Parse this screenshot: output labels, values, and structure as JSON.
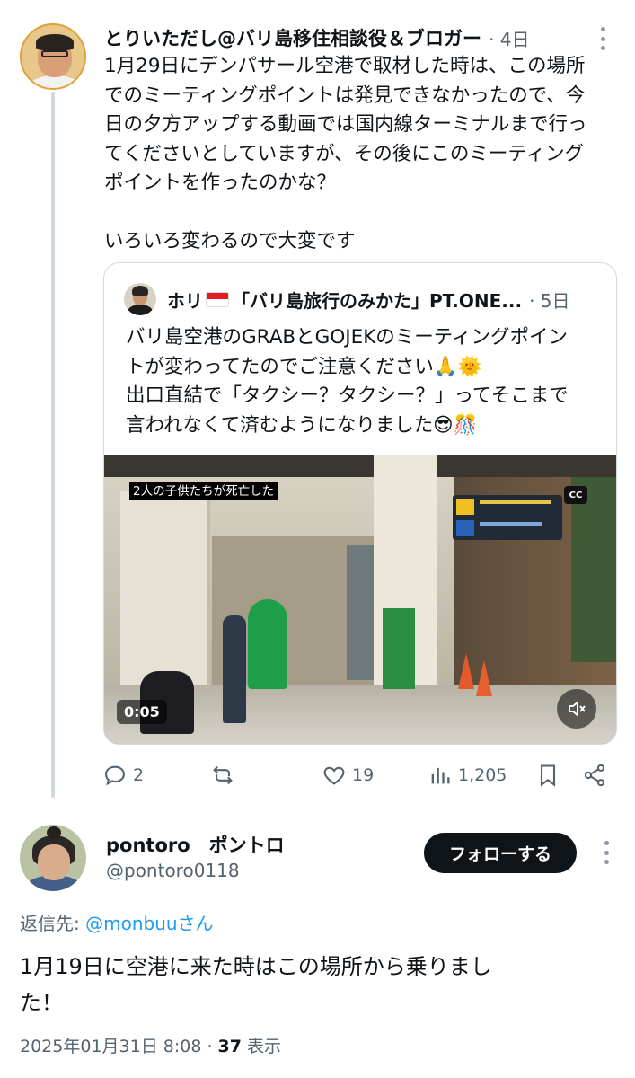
{
  "post1": {
    "author_name": "とりいただし@バリ島移住相談役＆ブロガー",
    "time": "· 4日",
    "text": "1月29日にデンパサール空港で取材した時は、この場所\nでのミーティングポイントは発見できなかったので、今\n日の夕方アップする動画では国内線ターミナルまで行っ\nてくださいとしていますが、その後にこのミーティング\nポイントを作ったのかな？\n\nいろいろ変わるので大変です",
    "quote": {
      "author_prefix": "ホリ",
      "author_rest": "「バリ島旅行のみかた」PT.ONE...",
      "flag_icon": "indonesia-flag-icon",
      "time": "· 5日",
      "text": "バリ島空港のGRABとGOJEKのミーティングポイン\nトが変わってたのでご注意ください🙏🌞\n出口直結で「タクシー？タクシー？」ってそこまで\n言われなくて済むようになりました😎🎊",
      "video": {
        "caption": "2人の子供たちが死亡した",
        "cc_label": "CC",
        "duration": "0:05",
        "mute_icon": "speaker-muted-icon"
      }
    },
    "actions": {
      "replies": "2",
      "retweets": "",
      "likes": "19",
      "views": "1,205"
    }
  },
  "post2": {
    "display_name": "pontoro　ポントロ",
    "handle": "@pontoro0118",
    "follow_label": "フォローする",
    "reply_prefix": "返信先: ",
    "reply_mention": "@monbuuさん",
    "text": "1月19日に空港に来た時はこの場所から乗りまし\nた！",
    "timestamp": "2025年01月31日 8:08 · ",
    "view_count": "37",
    "view_suffix": " 表示"
  },
  "colors": {
    "text": "#0f1419",
    "secondary": "#536471",
    "link": "#1d9bf0",
    "border": "#cfd9de",
    "follow_button": "#0f1419"
  }
}
